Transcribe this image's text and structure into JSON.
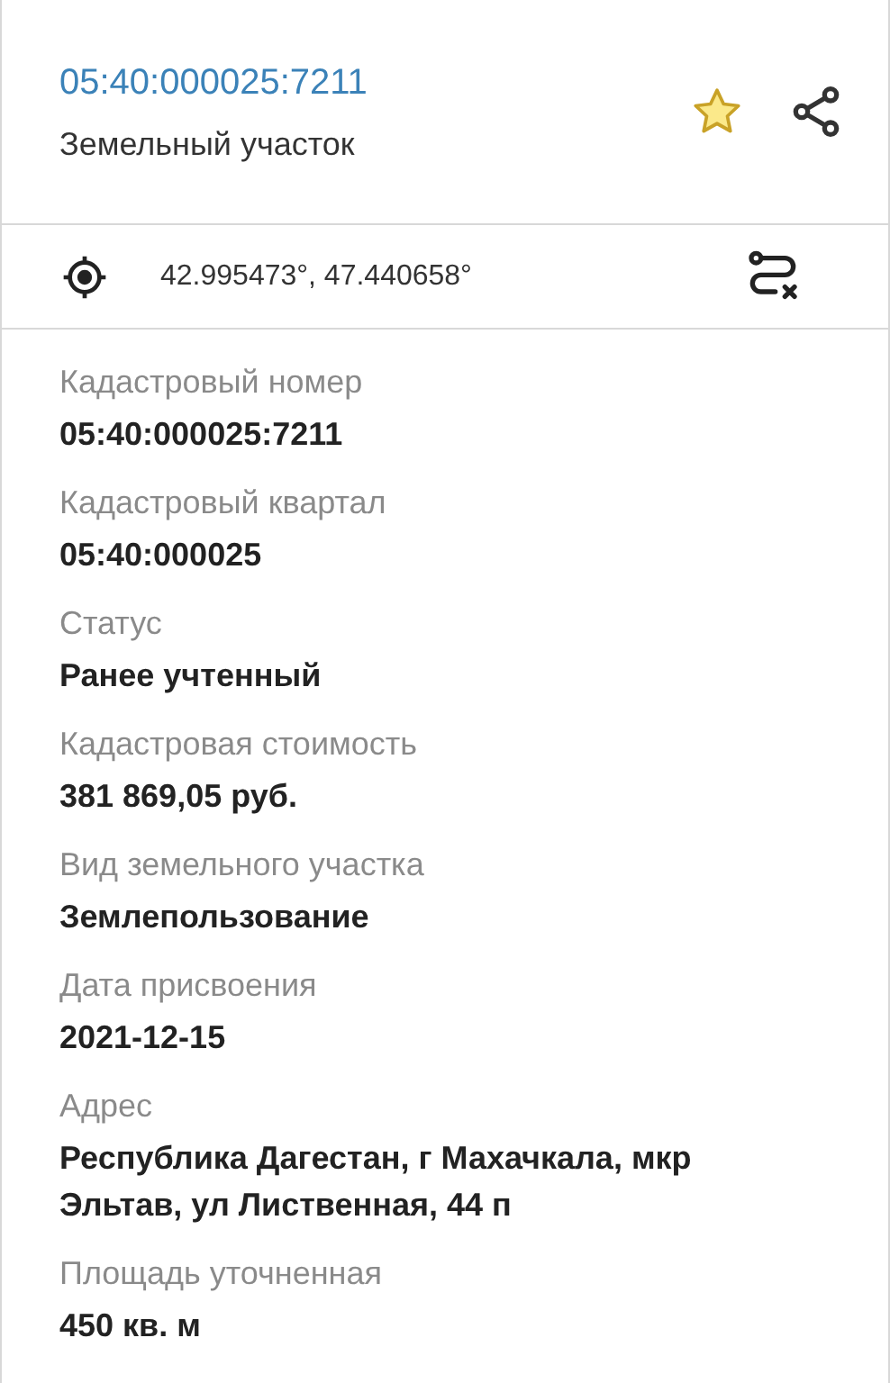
{
  "header": {
    "cadastral_number": "05:40:000025:7211",
    "type": "Земельный участок",
    "favorite": true
  },
  "location": {
    "coordinates": "42.995473°, 47.440658°"
  },
  "fields": [
    {
      "label": "Кадастровый номер",
      "value": "05:40:000025:7211"
    },
    {
      "label": "Кадастровый квартал",
      "value": "05:40:000025"
    },
    {
      "label": "Статус",
      "value": "Ранее учтенный"
    },
    {
      "label": "Кадастровая стоимость",
      "value": "381 869,05 руб."
    },
    {
      "label": "Вид земельного участка",
      "value": "Землепользование"
    },
    {
      "label": "Дата присвоения",
      "value": "2021-12-15"
    },
    {
      "label": "Адрес",
      "value": "Республика Дагестан, г Махачкала, мкр Эльтав, ул Лиственная, 44 п"
    },
    {
      "label": "Площадь уточненная",
      "value": "450 кв. м"
    }
  ]
}
